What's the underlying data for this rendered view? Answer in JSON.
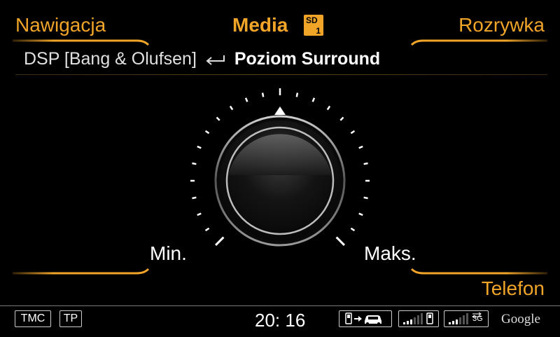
{
  "menu": {
    "navigation": "Nawigacja",
    "media": "Media",
    "entertainment": "Rozrywka",
    "phone": "Telefon",
    "media_source_badge": "SD",
    "media_source_number": "1"
  },
  "breadcrumb": {
    "parent": "DSP [Bang & Olufsen]",
    "title": "Poziom Surround"
  },
  "knob": {
    "min_label": "Min.",
    "max_label": "Maks.",
    "level": 0.5
  },
  "statusbar": {
    "tmc": "TMC",
    "tp": "TP",
    "time": "20: 16",
    "network_label": "3G",
    "brand": "Google"
  },
  "colors": {
    "accent": "#f0a428",
    "background": "#000000"
  },
  "icons": [
    "back-arrow-icon",
    "phone-to-car-icon",
    "signal-strength-icon",
    "data-signal-icon"
  ]
}
